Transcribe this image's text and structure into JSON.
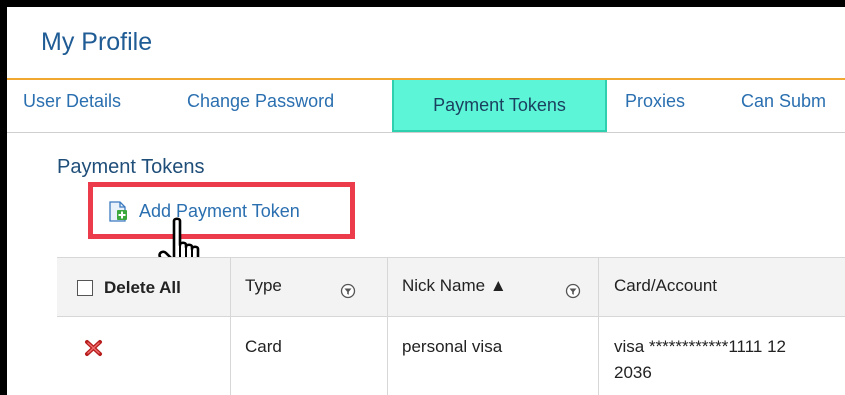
{
  "header": {
    "title": "My Profile"
  },
  "tabs": [
    {
      "label": "User Details",
      "active": false
    },
    {
      "label": "Change Password",
      "active": false
    },
    {
      "label": "Payment Tokens",
      "active": true
    },
    {
      "label": "Proxies",
      "active": false
    },
    {
      "label": "Can Subm",
      "active": false
    }
  ],
  "section": {
    "title": "Payment Tokens",
    "add_button": "Add Payment Token",
    "highlight_color": "#ec3b4a"
  },
  "grid": {
    "columns": [
      {
        "label": "Delete All"
      },
      {
        "label": "Type"
      },
      {
        "label": "Nick Name ▲"
      },
      {
        "label": "Card/Account"
      }
    ],
    "rows": [
      {
        "type": "Card",
        "nick_name": "personal visa",
        "card_line1": "visa ************1111 12",
        "card_line2": "2036"
      }
    ]
  },
  "colors": {
    "accent": "#2a6fb0",
    "active_tab": "#5cf5d8",
    "tab_underline": "#f0a830"
  }
}
